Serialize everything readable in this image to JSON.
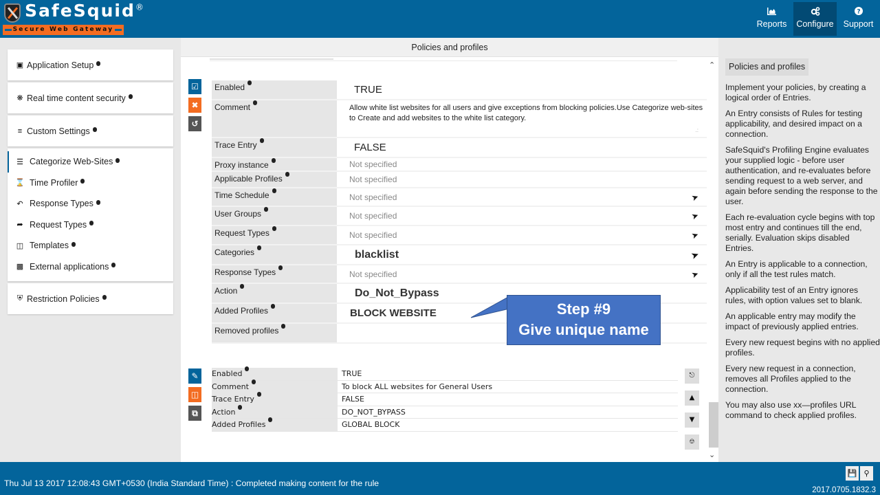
{
  "header": {
    "brand": "SafeSquid",
    "brand_mark": "®",
    "tagline": "Secure Web Gateway",
    "nav": [
      {
        "label": "Reports",
        "icon": "chart-icon",
        "active": false
      },
      {
        "label": "Configure",
        "icon": "gears-icon",
        "active": true
      },
      {
        "label": "Support",
        "icon": "question-icon",
        "active": false
      }
    ]
  },
  "sidebar": {
    "sections": [
      {
        "label": "Application Setup",
        "icon": "briefcase-icon"
      },
      {
        "label": "Real time content security",
        "icon": "bug-icon"
      },
      {
        "label": "Custom Settings",
        "icon": "sliders-icon"
      }
    ],
    "sub_items": [
      {
        "label": "Categorize Web-Sites",
        "icon": "database-icon",
        "active": true
      },
      {
        "label": "Time Profiler",
        "icon": "hourglass-icon"
      },
      {
        "label": "Response Types",
        "icon": "reply-icon"
      },
      {
        "label": "Request Types",
        "icon": "share-icon"
      },
      {
        "label": "Templates",
        "icon": "templates-icon"
      },
      {
        "label": "External applications",
        "icon": "external-link-icon"
      }
    ],
    "bottom": {
      "label": "Restriction Policies",
      "icon": "shield-icon"
    }
  },
  "main": {
    "title": "Policies and profiles",
    "edit_entry": {
      "fields": [
        {
          "label": "Enabled",
          "value": "TRUE"
        },
        {
          "label": "Comment",
          "value": "Allow white list websites for all users and give exceptions from blocking policies.Use Categorize web-sites to Create and add websites to the white list category."
        },
        {
          "label": "Trace Entry",
          "value": "FALSE"
        },
        {
          "label": "Proxy instance",
          "value": "Not specified"
        },
        {
          "label": "Applicable Profiles",
          "value": "Not specified"
        },
        {
          "label": "Time Schedule",
          "value": "Not specified"
        },
        {
          "label": "User Groups",
          "value": "Not specified"
        },
        {
          "label": "Request Types",
          "value": "Not specified"
        },
        {
          "label": "Categories",
          "value": "blacklist"
        },
        {
          "label": "Response Types",
          "value": "Not specified"
        },
        {
          "label": "Action",
          "value": "Do_Not_Bypass"
        },
        {
          "label": "Added Profiles",
          "value": "BLOCK WEBSITE"
        },
        {
          "label": "Removed profiles",
          "value": ""
        }
      ]
    },
    "callout": {
      "line1": "Step #9",
      "line2": "Give unique name"
    },
    "entry": {
      "fields": [
        {
          "label": "Enabled",
          "value": "TRUE"
        },
        {
          "label": "Comment",
          "value": "To block ALL websites for General Users"
        },
        {
          "label": "Trace Entry",
          "value": "FALSE"
        },
        {
          "label": "Action",
          "value": "DO_NOT_BYPASS"
        },
        {
          "label": "Added Profiles",
          "value": "GLOBAL BLOCK"
        }
      ]
    }
  },
  "help": {
    "title": "Policies and profiles",
    "paragraphs": [
      "Implement your policies, by creating a logical order of Entries.",
      "An Entry consists of Rules for testing applicability, and desired impact on a connection.",
      "SafeSquid's Profiling Engine evaluates your supplied logic - before user authentication, and re-evaluates before sending request to a web server, and again before sending the response to the user.",
      "Each re-evaluation cycle begins with top most entry and continues till the end, serially. Evaluation skips disabled Entries.",
      "An Entry is applicable to a connection, only if all the test rules match.",
      "Applicability test of an Entry ignores rules, with option values set to blank.",
      "An applicable entry may modify the impact of previously applied entries.",
      "Every new request begins with no applied profiles.",
      "Every new request in a connection, removes all Profiles applied to the connection.",
      "You may also use xx—profiles URL command to check applied profiles."
    ]
  },
  "footer": {
    "status": "Thu Jul 13 2017 12:08:43 GMT+0530 (India Standard Time) : Completed making content for the rule",
    "version": "2017.0705.1832.3"
  },
  "colors": {
    "primary": "#03649b",
    "accent": "#f36c21",
    "callout": "#4472c4"
  }
}
